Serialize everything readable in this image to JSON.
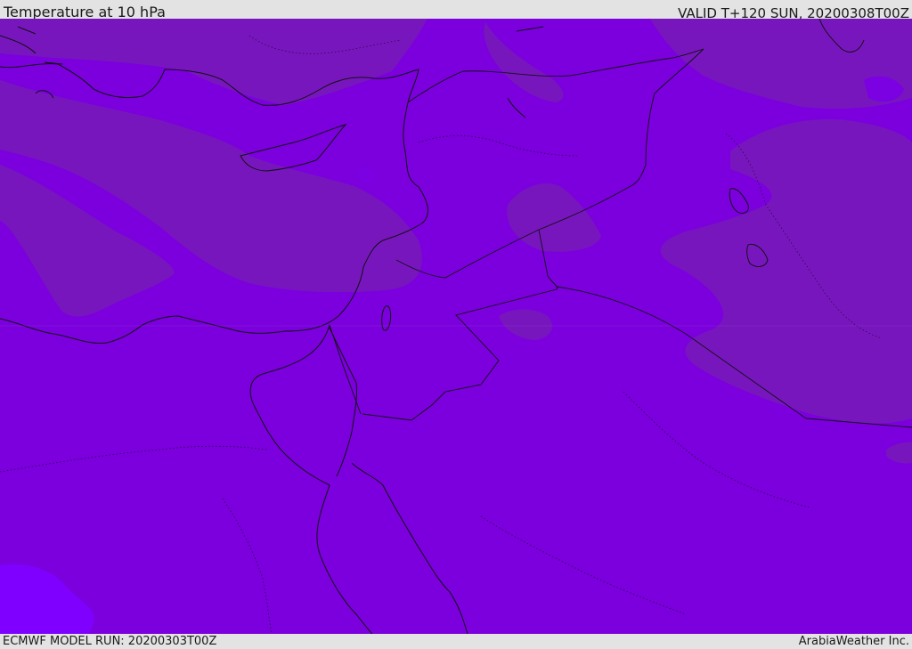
{
  "header": {
    "title": "Temperature at 10 hPa",
    "valid_time": "VALID T+120 SUN, 20200308T00Z"
  },
  "footer": {
    "model_run": "ECMWF MODEL RUN: 20200303T00Z",
    "credit": "ArabiaWeather Inc."
  },
  "colors": {
    "base_field": "#7b00dd",
    "cooler_field": "#7815bb",
    "warmer_field": "#7f00ff",
    "coastline": "#111111",
    "background": "#e3e3e3"
  },
  "map": {
    "variable": "Temperature",
    "level": "10 hPa"
  }
}
